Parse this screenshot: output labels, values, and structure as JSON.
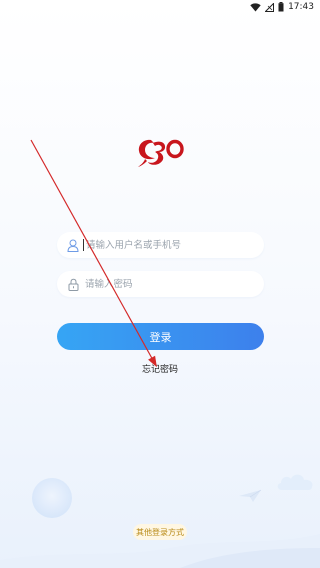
{
  "status_bar": {
    "time": "17:43"
  },
  "login": {
    "username_placeholder": "请输入用户名或手机号",
    "password_placeholder": "请输入密码",
    "login_label": "登录",
    "forgot_password": "忘记密码",
    "other_login": "其他登录方式"
  },
  "colors": {
    "accent_start": "#36a5f4",
    "accent_end": "#3d80ec",
    "logo": "#c8161d",
    "arrow": "#d42a2a"
  }
}
